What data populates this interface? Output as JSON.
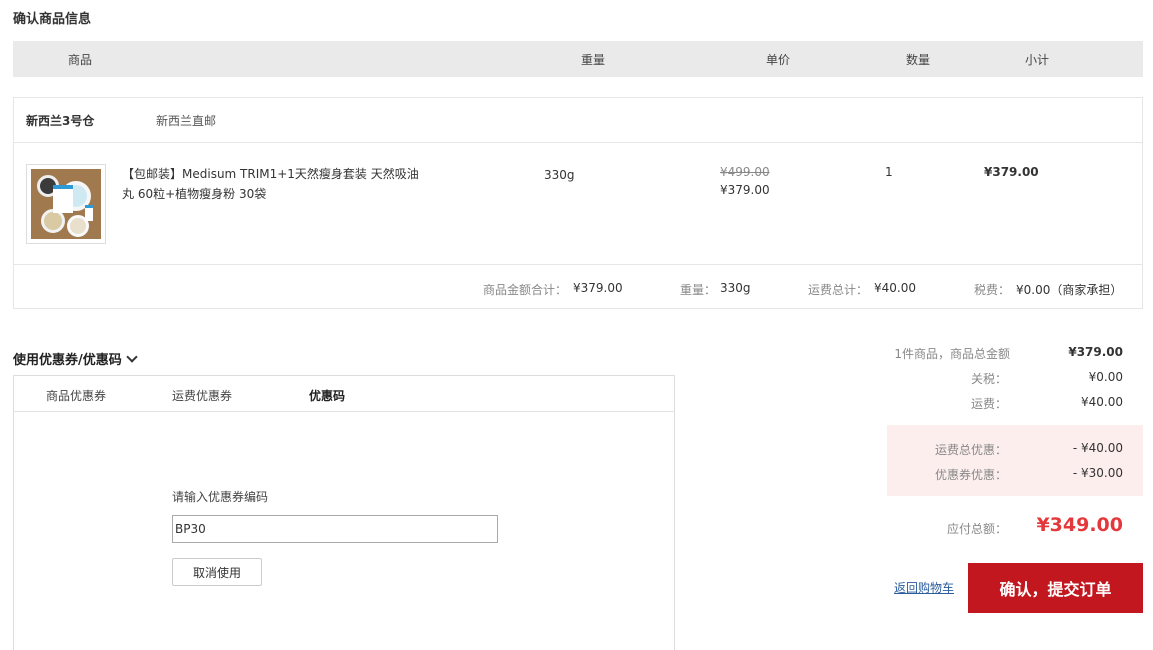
{
  "page_title": "确认商品信息",
  "table_header": {
    "product": "商品",
    "weight": "重量",
    "unit_price": "单价",
    "quantity": "数量",
    "subtotal": "小计"
  },
  "warehouse": {
    "name": "新西兰3号仓",
    "type": "新西兰直邮"
  },
  "item": {
    "name": "【包邮装】Medisum TRIM1+1天然瘦身套装 天然吸油丸 60粒+植物瘦身粉 30袋",
    "weight": "330g",
    "original_price": "¥499.00",
    "price": "¥379.00",
    "quantity": "1",
    "subtotal": "¥379.00"
  },
  "summary": {
    "goods_total_label": "商品金额合计：",
    "goods_total": "¥379.00",
    "weight_label": "重量：",
    "weight": "330g",
    "shipping_label": "运费总计：",
    "shipping": "¥40.00",
    "tax_label": "税费：",
    "tax": "¥0.00（商家承担）"
  },
  "coupon": {
    "title": "使用优惠券/优惠码",
    "tabs": [
      "商品优惠券",
      "运费优惠券",
      "优惠码"
    ],
    "active_tab": "优惠码",
    "input_label": "请输入优惠券编码",
    "input_value": "BP30",
    "cancel_label": "取消使用"
  },
  "totals": {
    "items_label": "1件商品，商品总金额",
    "items_value": "¥379.00",
    "duty_label": "关税：",
    "duty_value": "¥0.00",
    "shipping_label": "运费：",
    "shipping_value": "¥40.00",
    "shipping_discount_label": "运费总优惠：",
    "shipping_discount_value": "- ¥40.00",
    "coupon_discount_label": "优惠券优惠：",
    "coupon_discount_value": "- ¥30.00",
    "due_label": "应付总额：",
    "due_value": "¥349.00"
  },
  "actions": {
    "back_label": "返回购物车",
    "submit_label": "确认，提交订单"
  },
  "colors": {
    "accent_red": "#c3171f",
    "price_red": "#e4393c",
    "link_blue": "#2a5c9e",
    "discount_bg": "#fdeeee"
  }
}
